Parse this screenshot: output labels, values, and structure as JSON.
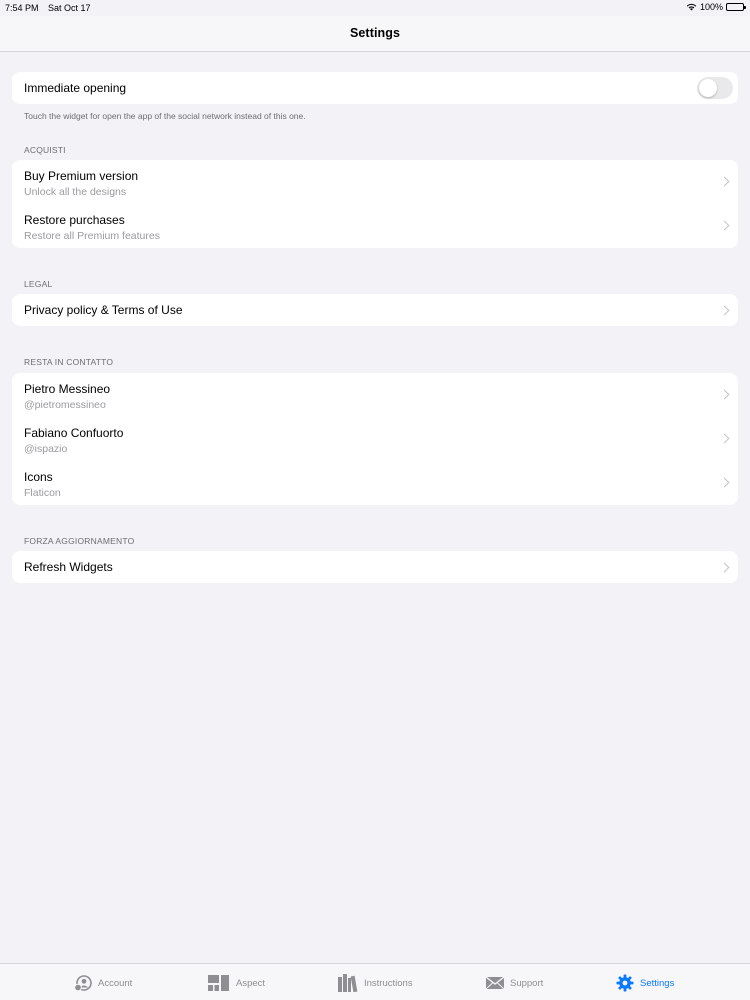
{
  "status_bar": {
    "time": "7:54 PM",
    "date": "Sat Oct 17",
    "battery": "100%"
  },
  "nav": {
    "title": "Settings"
  },
  "immediate_opening": {
    "label": "Immediate opening",
    "enabled": false,
    "footer": "Touch the widget for open the app of the social network instead of this one."
  },
  "sections": {
    "acquisti": {
      "header": "ACQUISTI",
      "rows": [
        {
          "title": "Buy Premium version",
          "subtitle": "Unlock all the designs"
        },
        {
          "title": "Restore purchases",
          "subtitle": "Restore all Premium features"
        }
      ]
    },
    "legal": {
      "header": "LEGAL",
      "rows": [
        {
          "title": "Privacy policy & Terms of Use"
        }
      ]
    },
    "contatto": {
      "header": "RESTA IN CONTATTO",
      "rows": [
        {
          "title": "Pietro Messineo",
          "subtitle": "@pietromessineo"
        },
        {
          "title": "Fabiano Confuorto",
          "subtitle": "@ispazio"
        },
        {
          "title": "Icons",
          "subtitle": "Flaticon"
        }
      ]
    },
    "aggiornamento": {
      "header": "FORZA AGGIORNAMENTO",
      "rows": [
        {
          "title": "Refresh Widgets"
        }
      ]
    }
  },
  "tabs": [
    {
      "label": "Account",
      "icon": "person-icon"
    },
    {
      "label": "Aspect",
      "icon": "layout-icon"
    },
    {
      "label": "Instructions",
      "icon": "books-icon"
    },
    {
      "label": "Support",
      "icon": "envelope-icon"
    },
    {
      "label": "Settings",
      "icon": "gear-icon",
      "active": true
    }
  ],
  "colors": {
    "accent": "#0a7aff",
    "background": "#f2f2f7",
    "inactive_tab": "#8e8e93"
  }
}
